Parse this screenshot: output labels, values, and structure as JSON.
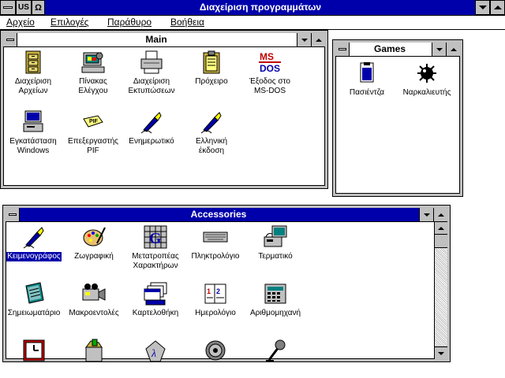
{
  "app": {
    "title": "Διαχείριση προγραμμάτων",
    "lang_indicator": "US",
    "omega_indicator": "Ω"
  },
  "menu": {
    "items": [
      {
        "label": "Αρχείο"
      },
      {
        "label": "Επιλογές"
      },
      {
        "label": "Παράθυρο"
      },
      {
        "label": "Βοήθεια"
      }
    ]
  },
  "main": {
    "title": "Main",
    "icons": [
      {
        "label": "Διαχείριση\nΑρχείων",
        "icon": "file-manager-icon"
      },
      {
        "label": "Πίνακας\nΕλέγχου",
        "icon": "control-panel-icon"
      },
      {
        "label": "Διαχείριση\nΕκτυπώσεων",
        "icon": "print-manager-icon"
      },
      {
        "label": "Πρόχειρο",
        "icon": "clipboard-icon"
      },
      {
        "label": "Έξοδος στο\nMS-DOS",
        "icon": "ms-dos-icon"
      },
      {
        "label": "Εγκατάσταση\nWindows",
        "icon": "windows-setup-icon"
      },
      {
        "label": "Επεξεργαστής\nPIF",
        "icon": "pif-editor-icon"
      },
      {
        "label": "Ενημερωτικό",
        "icon": "pen-icon"
      },
      {
        "label": "Ελληνική\nέκδοση",
        "icon": "pen-icon"
      }
    ]
  },
  "games": {
    "title": "Games",
    "icons": [
      {
        "label": "Πασιέντζα",
        "icon": "solitaire-icon"
      },
      {
        "label": "Ναρκαλιευτής",
        "icon": "minesweeper-icon"
      }
    ]
  },
  "accessories": {
    "title": "Accessories",
    "icons": [
      {
        "label": "Κειμενογράφος",
        "icon": "write-icon",
        "selected": true
      },
      {
        "label": "Ζωγραφική",
        "icon": "paintbrush-icon"
      },
      {
        "label": "Μετατροπέας\nΧαρακτήρων",
        "icon": "character-map-icon"
      },
      {
        "label": "Πληκτρολόγιο",
        "icon": "keyboard-icon"
      },
      {
        "label": "Τερματικό",
        "icon": "terminal-icon"
      },
      {
        "label": "Σημειωματάριο",
        "icon": "notepad-icon"
      },
      {
        "label": "Μακροεντολές",
        "icon": "recorder-icon"
      },
      {
        "label": "Καρτελοθήκη",
        "icon": "cardfile-icon"
      },
      {
        "label": "Ημερολόγιο",
        "icon": "calendar-icon"
      },
      {
        "label": "Αριθμομηχανή",
        "icon": "calculator-icon"
      },
      {
        "label": "",
        "icon": "clock-icon"
      },
      {
        "label": "",
        "icon": "object-packager-icon"
      },
      {
        "label": "",
        "icon": "sound-recorder-icon"
      },
      {
        "label": "",
        "icon": "media-player-icon"
      },
      {
        "label": "",
        "icon": "microphone-icon"
      }
    ]
  },
  "colors": {
    "title_active": "#0000aa",
    "frame": "#c0c0c0",
    "selection": "#0000aa"
  }
}
